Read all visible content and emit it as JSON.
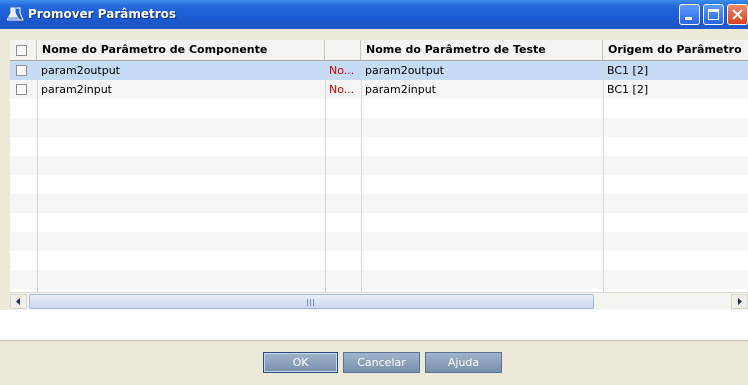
{
  "window": {
    "title": "Promover Parâmetros",
    "icon": "flask-icon",
    "controls": [
      "minimize-icon",
      "maximize-icon",
      "close-icon"
    ]
  },
  "grid": {
    "columns": [
      "Nome do Parâmetro de Componente",
      "",
      "Nome do Parâmetro de Teste",
      "Origem do Parâmetro"
    ],
    "rows": [
      {
        "checked": false,
        "component_param": "param2output",
        "status": "No...",
        "test_param": "param2output",
        "origin": "BC1 [2]",
        "selected": true
      },
      {
        "checked": false,
        "component_param": "param2input",
        "status": "No...",
        "test_param": "param2input",
        "origin": "BC1 [2]",
        "selected": false
      }
    ]
  },
  "buttons": {
    "ok": "OK",
    "cancel": "Cancelar",
    "help": "Ajuda"
  },
  "colors": {
    "title_bar": "#1c5ed6",
    "selected_row": "#c6dcf6",
    "status_text": "#d00000",
    "button": "#7990ae"
  }
}
